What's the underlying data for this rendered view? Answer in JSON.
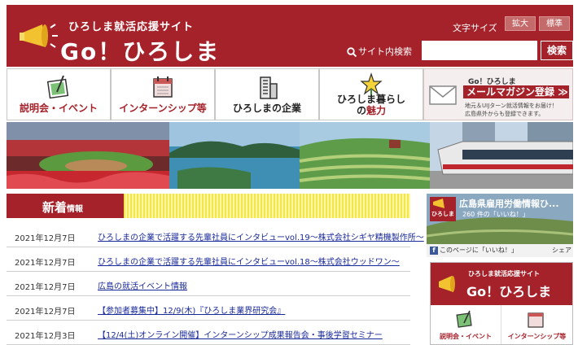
{
  "header": {
    "site_subtitle": "ひろしま就活応援サイト",
    "site_title": "Go！ひろしま",
    "font_size_label": "文字サイズ",
    "font_size_large": "拡大",
    "font_size_standard": "標準",
    "search_label": "サイト内検索",
    "search_placeholder": "",
    "search_button": "検索"
  },
  "nav": {
    "items": [
      {
        "label": "説明会・イベント",
        "icon": "map-icon"
      },
      {
        "label": "インターンシップ等",
        "icon": "calendar-icon"
      },
      {
        "label": "ひろしまの企業",
        "icon": "building-icon"
      },
      {
        "label_line1": "ひろしま暮らし",
        "label_line2": "の",
        "label_red": "魅力",
        "icon": "star-flower-icon"
      }
    ]
  },
  "magazine": {
    "sub": "Go！ひろしま",
    "title": "メールマガジン登録 ≫",
    "desc1": "地元＆UIJターン就活情報をお届け！",
    "desc2": "広島県外からも登録できます。"
  },
  "news": {
    "heading": "新着",
    "heading_small": "情報",
    "items": [
      {
        "date": "2021年12月7日",
        "title": "ひろしまの企業で活躍する先輩社員にインタビューvol.19～株式会社シギヤ精機製作所～"
      },
      {
        "date": "2021年12月7日",
        "title": "ひろしまの企業で活躍する先輩社員にインタビューvol.18～株式会社ウッドワン～"
      },
      {
        "date": "2021年12月7日",
        "title": "広島の就活イベント情報"
      },
      {
        "date": "2021年12月7日",
        "title": "【参加者募集中】12/9(木)『ひろしま業界研究会』"
      },
      {
        "date": "2021年12月3日",
        "title": "【12/4(土)オンライン開催】インターンシップ成果報告会・事後学習セミナー"
      }
    ]
  },
  "facebook": {
    "page_name": "広島県雇用労働情報ひ...",
    "likes": "260 件の「いいね！」",
    "avatar_text": "ひろしま",
    "like_label": "このページに「いいね！」",
    "share_label": "シェア"
  },
  "right_banner": {
    "sub": "ひろしま就活応援サイト",
    "title": "Go！ひろしま",
    "item1": "説明会・イベント",
    "item2": "インターンシップ等"
  },
  "colors": {
    "brand": "#a6222b",
    "link": "#1a2a9a",
    "stripe": "#f2e64a"
  }
}
